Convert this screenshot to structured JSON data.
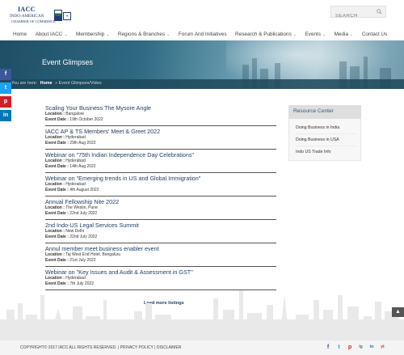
{
  "logo": {
    "line1": "IACC",
    "line2": "INDO-AMERICAN",
    "line3": "CHAMBER OF COMMERCE"
  },
  "search": {
    "placeholder": "SEARCH",
    "icon": "search-icon"
  },
  "nav": [
    {
      "label": "Home",
      "dropdown": false
    },
    {
      "label": "About IACC",
      "dropdown": true
    },
    {
      "label": "Membership",
      "dropdown": true
    },
    {
      "label": "Regions & Branches",
      "dropdown": true
    },
    {
      "label": "Forum And Initiatives",
      "dropdown": false
    },
    {
      "label": "Research & Publications",
      "dropdown": true
    },
    {
      "label": "Events",
      "dropdown": true
    },
    {
      "label": "Media",
      "dropdown": true
    },
    {
      "label": "Contact Us",
      "dropdown": false
    }
  ],
  "banner": {
    "title": "Event Glimpses",
    "breadcrumb_prefix": "You are here:",
    "breadcrumb_home": "Home",
    "breadcrumb_current": "» Event Glimpses/Video"
  },
  "social_share": [
    "f",
    "t",
    "p",
    "in"
  ],
  "events": [
    {
      "title": "Scaling Your Business The Mysore Angle",
      "location": "Bangalore",
      "date": "19th October 2022"
    },
    {
      "title": "IACC AP & TS Members' Meet & Greet 2022",
      "location": "Hyderabad",
      "date": "29th Aug 2022"
    },
    {
      "title": "Webinar on \"75th Indian Independence Day Celebrations\"",
      "location": "Hyderabad",
      "date": "14th Aug 2022"
    },
    {
      "title": "Webinar on \"Emerging trends in US and Global Immigration\"",
      "location": "Hyderabad",
      "date": "4th August 2022"
    },
    {
      "title": "Annual Fellowship Nite 2022",
      "location": "The Westin, Pune",
      "date": "22nd July 2022"
    },
    {
      "title": "2nd Indo-US Legal Services Summit",
      "location": "New Delhi",
      "date": "22nd July 2022"
    },
    {
      "title": "Annul member meet business enabler event",
      "location": "Taj West End Hotel, Bengaluru",
      "date": "21st July 2022"
    },
    {
      "title": "Webinar on \"Key Issues and Audit & Assessment in GST\"",
      "location": "Hyderabad",
      "date": "7th July 2022"
    }
  ],
  "labels": {
    "location": "Location :",
    "date": "Event Date :"
  },
  "load_more": "Load more listings",
  "resource_center": {
    "heading": "Resource Center",
    "items": [
      "Doing Business in India",
      "Doing Business in USA",
      "Indo US Trade Info"
    ]
  },
  "footer": {
    "copyright": "COPYRIGHT© 2017 IACC ALL RIGHTS RESERVED.",
    "sep": " | ",
    "privacy": "PRIVACY POLICY",
    "disclaimer": "DISCLAIMER",
    "social": [
      "f",
      "t",
      "p",
      "ig",
      "in",
      "yt"
    ]
  },
  "colors": {
    "title_blue": "#1f3f66",
    "fb": "#3b5998",
    "twitter": "#1da1f2",
    "pinterest": "#cb2027",
    "linkedin": "#0077b5",
    "youtube": "#e52d27"
  }
}
